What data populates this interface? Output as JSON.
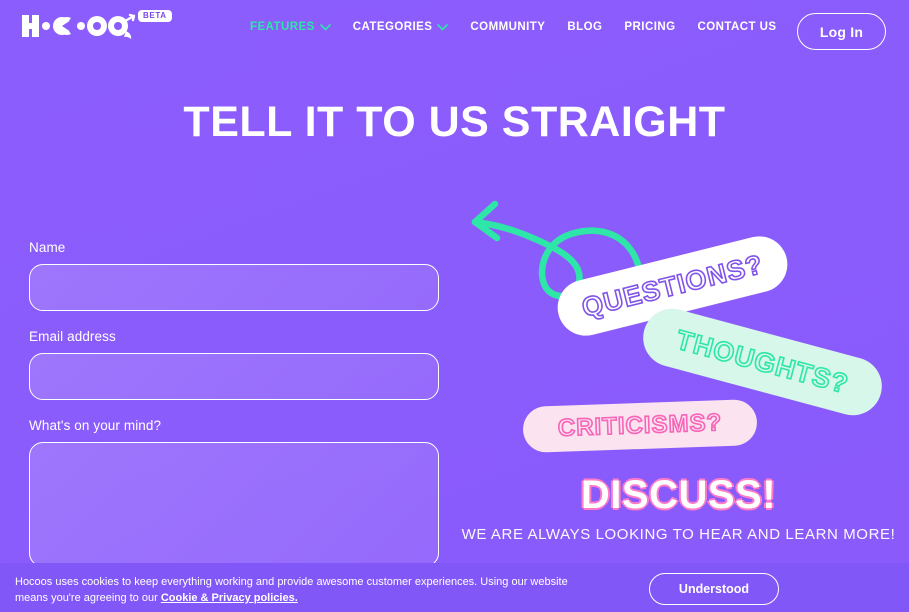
{
  "theme": {
    "bg_purple": "#8B5CFC",
    "accent_mint": "#2EE6A8",
    "accent_pink": "#F764B8",
    "white": "#FFFFFF",
    "cookiebar_purple": "#8257F8"
  },
  "nav": {
    "logo_text": "HOCOOS",
    "beta_label": "BETA",
    "items": [
      {
        "label": "FEATURES",
        "active": true,
        "has_chevron": true
      },
      {
        "label": "CATEGORIES",
        "active": false,
        "has_chevron": true
      },
      {
        "label": "COMMUNITY",
        "active": false,
        "has_chevron": false
      },
      {
        "label": "BLOG",
        "active": false,
        "has_chevron": false
      },
      {
        "label": "PRICING",
        "active": false,
        "has_chevron": false
      },
      {
        "label": "CONTACT US",
        "active": false,
        "has_chevron": false
      }
    ],
    "login_label": "Log In"
  },
  "hero": {
    "title": "TELL IT TO US STRAIGHT"
  },
  "form": {
    "name_label": "Name",
    "name_value": "",
    "name_placeholder": "",
    "email_label": "Email address",
    "email_value": "",
    "email_placeholder": "",
    "message_label": "What's on your mind?",
    "message_value": "",
    "message_placeholder": ""
  },
  "decor": {
    "badges": [
      {
        "label": "QUESTIONS?",
        "pill_color": "#FFFFFF",
        "text_color": "#8054E8"
      },
      {
        "label": "THOUGHTS?",
        "pill_color": "#D6F7EA",
        "text_color": "#2EE6A8"
      },
      {
        "label": "CRITICISMS?",
        "pill_color": "#FBE3F0",
        "text_color": "#F764B8"
      }
    ],
    "arrow_color": "#2EE6A8",
    "discuss_title": "DISCUSS!",
    "discuss_subtitle": "WE ARE ALWAYS LOOKING TO HEAR AND LEARN MORE!"
  },
  "cookie": {
    "text_before": "Hocoos uses cookies to keep everything working and provide awesome customer experiences. Using our website means you're agreeing to our ",
    "link_label": "Cookie & Privacy policies.",
    "button_label": "Understood"
  }
}
